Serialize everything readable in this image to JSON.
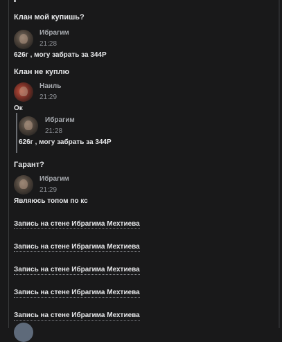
{
  "messages": {
    "m1_text": "Клан мой купишь?",
    "m2_name": "Ибрагим",
    "m2_time": "21:28",
    "m2_text": "626г , могу забрать за 344Р",
    "m3_text": "Клан не куплю",
    "m4_name": "Наиль",
    "m4_time": "21:29",
    "m4_text": "Ок",
    "quote_name": "Ибрагим",
    "quote_time": "21:28",
    "quote_text": "626г , могу забрать за 344Р",
    "m5_text": "Гарант?",
    "m6_name": "Ибрагим",
    "m6_time": "21:29",
    "m6_text": "Являюсь топом по кс"
  },
  "wall_links": [
    "Запись на стене Ибрагима Мехтиева",
    "Запись на стене Ибрагима Мехтиева",
    "Запись на стене Ибрагима Мехтиева",
    "Запись на стене Ибрагима Мехтиева",
    "Запись на стене Ибрагима Мехтиева"
  ]
}
